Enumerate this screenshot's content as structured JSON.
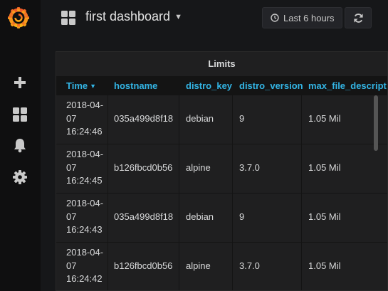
{
  "header": {
    "dashboard_title": "first dashboard",
    "time_range_label": "Last 6 hours"
  },
  "sidebar": {
    "items": [
      {
        "icon": "grafana-logo-icon"
      },
      {
        "icon": "plus-icon"
      },
      {
        "icon": "dashboards-icon"
      },
      {
        "icon": "bell-icon"
      },
      {
        "icon": "gear-icon"
      }
    ]
  },
  "panel": {
    "title": "Limits",
    "columns": [
      "Time",
      "hostname",
      "distro_key",
      "distro_version",
      "max_file_descript"
    ],
    "sort_column": "Time",
    "rows": [
      {
        "time_l1": "2018-04-",
        "time_l2": "07",
        "time_l3": "16:24:46",
        "hostname": "035a499d8f18",
        "distro_key": "debian",
        "distro_version": "9",
        "max_file": "1.05 Mil"
      },
      {
        "time_l1": "2018-04-",
        "time_l2": "07",
        "time_l3": "16:24:45",
        "hostname": "b126fbcd0b56",
        "distro_key": "alpine",
        "distro_version": "3.7.0",
        "max_file": "1.05 Mil"
      },
      {
        "time_l1": "2018-04-",
        "time_l2": "07",
        "time_l3": "16:24:43",
        "hostname": "035a499d8f18",
        "distro_key": "debian",
        "distro_version": "9",
        "max_file": "1.05 Mil"
      },
      {
        "time_l1": "2018-04-",
        "time_l2": "07",
        "time_l3": "16:24:42",
        "hostname": "b126fbcd0b56",
        "distro_key": "alpine",
        "distro_version": "3.7.0",
        "max_file": "1.05 Mil"
      }
    ]
  },
  "colors": {
    "accent_blue": "#33b5e5",
    "logo_orange": "#f05a28",
    "background": "#161719",
    "panel": "#1f1f20"
  }
}
